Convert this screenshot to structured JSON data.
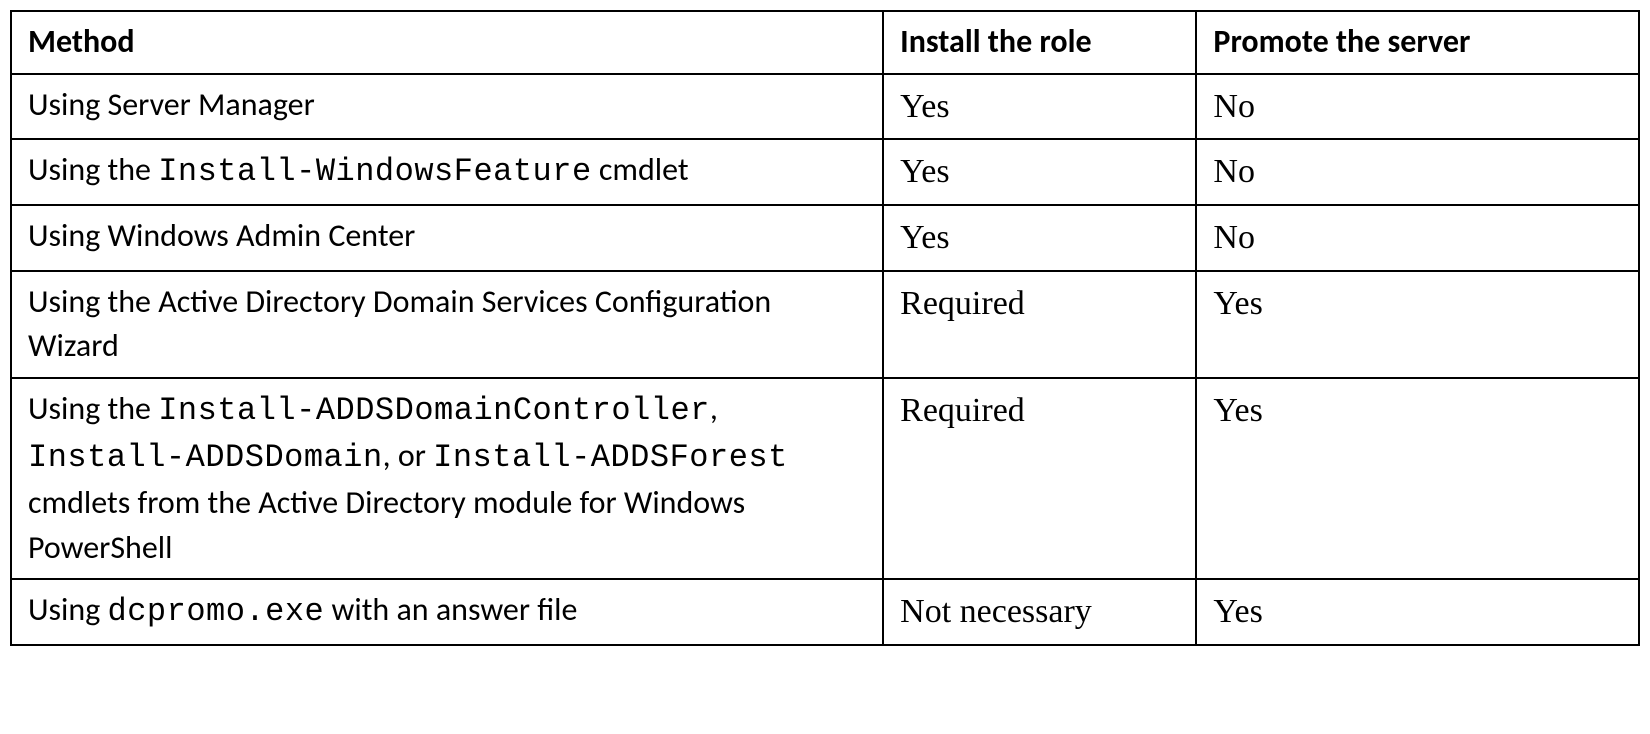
{
  "headers": {
    "method": "Method",
    "install": "Install the role",
    "promote": "Promote the server"
  },
  "rows": [
    {
      "method_html": "Using Server Manager",
      "install": "Yes",
      "promote": "No"
    },
    {
      "method_html": "Using the <code>Install-WindowsFeature</code> cmdlet",
      "install": "Yes",
      "promote": "No"
    },
    {
      "method_html": "Using Windows Admin Center",
      "install": "Yes",
      "promote": "No"
    },
    {
      "method_html": "Using the Active Directory Domain Services Configuration Wizard",
      "install": "Required",
      "promote": "Yes"
    },
    {
      "method_html": "Using the <code>Install-ADDSDomainController</code>, <code>Install-ADDSDomain</code>, or <code>Install-ADDSForest</code> cmdlets from the Active Directory module for Windows PowerShell",
      "install": "Required",
      "promote": "Yes"
    },
    {
      "method_html": "Using <code>dcpromo.exe</code> with an answer file",
      "install": "Not necessary",
      "promote": "Yes"
    }
  ]
}
